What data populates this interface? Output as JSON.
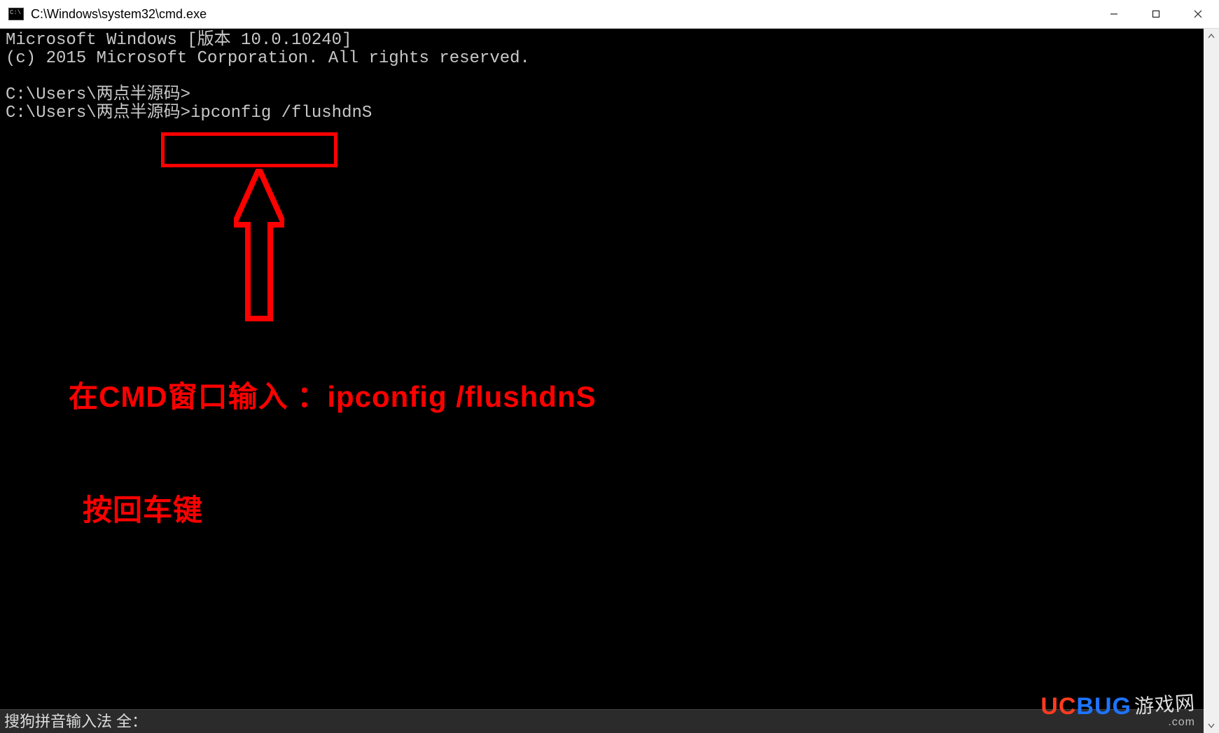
{
  "titlebar": {
    "title": "C:\\Windows\\system32\\cmd.exe"
  },
  "console": {
    "line1": "Microsoft Windows [版本 10.0.10240]",
    "line2": "(c) 2015 Microsoft Corporation. All rights reserved.",
    "prompt1": "C:\\Users\\两点半源码>",
    "prompt2": "C:\\Users\\两点半源码>",
    "command": "ipconfig /flushdnS"
  },
  "annotations": {
    "line1": "在CMD窗口输入 ：ipconfig /flushdnS",
    "line2": "按回车键"
  },
  "ime": {
    "text": "搜狗拼音输入法 全："
  },
  "watermark": {
    "uc": "UC",
    "bug": "BUG",
    "cn": "游戏网",
    "com": ".com"
  }
}
